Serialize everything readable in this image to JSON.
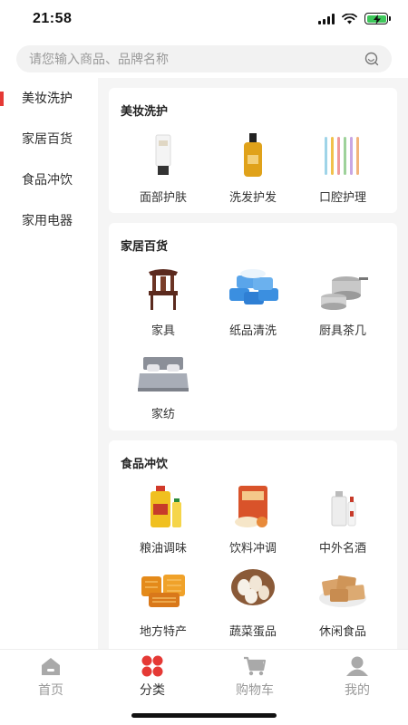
{
  "status": {
    "time": "21:58"
  },
  "search": {
    "placeholder": "请您输入商品、品牌名称"
  },
  "sidebar": {
    "items": [
      {
        "label": "美妆洗护",
        "active": true
      },
      {
        "label": "家居百货",
        "active": false
      },
      {
        "label": "食品冲饮",
        "active": false
      },
      {
        "label": "家用电器",
        "active": false
      }
    ]
  },
  "sections": [
    {
      "title": "美妆洗护",
      "items": [
        {
          "label": "面部护肤",
          "icon": "face-cream-icon"
        },
        {
          "label": "洗发护发",
          "icon": "shampoo-bottle-icon"
        },
        {
          "label": "口腔护理",
          "icon": "toothbrush-icon"
        }
      ]
    },
    {
      "title": "家居百货",
      "items": [
        {
          "label": "家具",
          "icon": "chair-icon"
        },
        {
          "label": "纸品清洗",
          "icon": "tissue-pack-icon"
        },
        {
          "label": "厨具茶几",
          "icon": "cookware-icon"
        },
        {
          "label": "家纺",
          "icon": "bed-icon"
        }
      ]
    },
    {
      "title": "食品冲饮",
      "items": [
        {
          "label": "粮油调味",
          "icon": "cooking-oil-icon"
        },
        {
          "label": "饮料冲调",
          "icon": "drink-pack-icon"
        },
        {
          "label": "中外名酒",
          "icon": "liquor-icon"
        },
        {
          "label": "地方特产",
          "icon": "honeycomb-icon"
        },
        {
          "label": "蔬菜蛋品",
          "icon": "eggs-icon"
        },
        {
          "label": "休闲食品",
          "icon": "crackers-icon"
        }
      ]
    }
  ],
  "tabbar": {
    "items": [
      {
        "label": "首页",
        "icon": "home-icon",
        "active": false
      },
      {
        "label": "分类",
        "icon": "category-icon",
        "active": true
      },
      {
        "label": "购物车",
        "icon": "cart-icon",
        "active": false
      },
      {
        "label": "我的",
        "icon": "profile-icon",
        "active": false
      }
    ]
  },
  "colors": {
    "accent": "#e53935",
    "inactive_tab": "#999999",
    "panel_bg": "#f5f5f5"
  }
}
